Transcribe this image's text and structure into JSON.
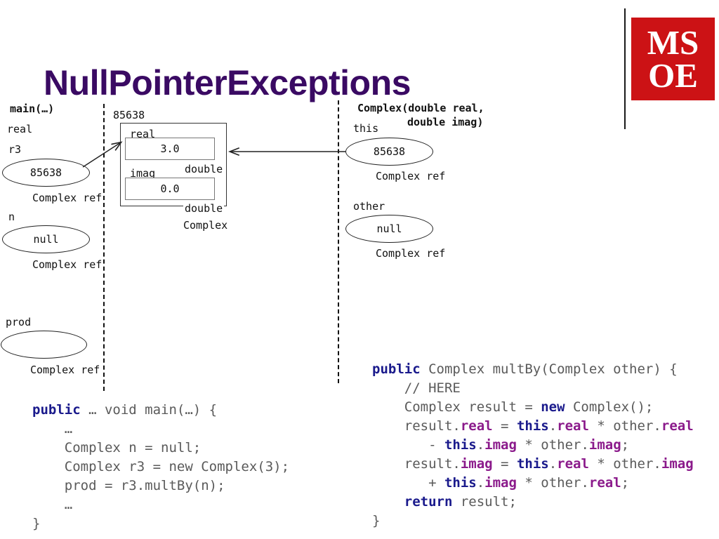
{
  "slide": {
    "title": "NullPointerExceptions",
    "title_color": "#3A0A63"
  },
  "logo": {
    "name": "msoe-logo",
    "line1": "MS",
    "line2": "OE",
    "background_color": "#CC1215",
    "text_color": "#FFFFFF"
  },
  "left_frame": {
    "frame_label": "main(…)",
    "stray_label": "real",
    "variables": [
      {
        "name": "r3",
        "value": "85638",
        "type_label": "Complex ref"
      },
      {
        "name": "n",
        "value": "null",
        "type_label": "Complex ref"
      },
      {
        "name": "prod",
        "value": "",
        "type_label": "Complex ref"
      }
    ]
  },
  "heap": {
    "address": "85638",
    "class_label": "Complex",
    "fields": [
      {
        "name": "real",
        "value": "3.0",
        "type_label": "double"
      },
      {
        "name": "imag",
        "value": "0.0",
        "type_label": "double"
      }
    ]
  },
  "right_frame": {
    "frame_label_line1": "Complex(double real,",
    "frame_label_line2": "double imag)",
    "variables": [
      {
        "name": "this",
        "value": "85638",
        "type_label": "Complex ref"
      },
      {
        "name": "other",
        "value": "null",
        "type_label": "Complex ref"
      }
    ]
  },
  "code_main": {
    "lines": [
      [
        {
          "t": "public",
          "c": "kw"
        },
        {
          "t": " … void main(…) {",
          "c": "plain"
        }
      ],
      [
        {
          "t": "    …",
          "c": "plain"
        }
      ],
      [
        {
          "t": "    Complex n = null;",
          "c": "plain"
        }
      ],
      [
        {
          "t": "    Complex r3 = new Complex(3);",
          "c": "plain"
        }
      ],
      [
        {
          "t": "    prod = r3.multBy(n);",
          "c": "plain"
        }
      ],
      [
        {
          "t": "    …",
          "c": "plain"
        }
      ],
      [
        {
          "t": "}",
          "c": "plain"
        }
      ]
    ]
  },
  "code_multby": {
    "lines": [
      [
        {
          "t": "public",
          "c": "kw"
        },
        {
          "t": " Complex multBy(Complex other) {",
          "c": "plain"
        }
      ],
      [
        {
          "t": "    // HERE",
          "c": "plain"
        }
      ],
      [
        {
          "t": "    Complex result = ",
          "c": "plain"
        },
        {
          "t": "new",
          "c": "kw"
        },
        {
          "t": " Complex();",
          "c": "plain"
        }
      ],
      [
        {
          "t": "    result.",
          "c": "plain"
        },
        {
          "t": "real",
          "c": "fld"
        },
        {
          "t": " = ",
          "c": "plain"
        },
        {
          "t": "this",
          "c": "kw"
        },
        {
          "t": ".",
          "c": "plain"
        },
        {
          "t": "real",
          "c": "fld"
        },
        {
          "t": " * other.",
          "c": "plain"
        },
        {
          "t": "real",
          "c": "fld"
        }
      ],
      [
        {
          "t": "       - ",
          "c": "plain"
        },
        {
          "t": "this",
          "c": "kw"
        },
        {
          "t": ".",
          "c": "plain"
        },
        {
          "t": "imag",
          "c": "fld"
        },
        {
          "t": " * other.",
          "c": "plain"
        },
        {
          "t": "imag",
          "c": "fld"
        },
        {
          "t": ";",
          "c": "plain"
        }
      ],
      [
        {
          "t": "    result.",
          "c": "plain"
        },
        {
          "t": "imag",
          "c": "fld"
        },
        {
          "t": " = ",
          "c": "plain"
        },
        {
          "t": "this",
          "c": "kw"
        },
        {
          "t": ".",
          "c": "plain"
        },
        {
          "t": "real",
          "c": "fld"
        },
        {
          "t": " * other.",
          "c": "plain"
        },
        {
          "t": "imag",
          "c": "fld"
        }
      ],
      [
        {
          "t": "       + ",
          "c": "plain"
        },
        {
          "t": "this",
          "c": "kw"
        },
        {
          "t": ".",
          "c": "plain"
        },
        {
          "t": "imag",
          "c": "fld"
        },
        {
          "t": " * other.",
          "c": "plain"
        },
        {
          "t": "real",
          "c": "fld"
        },
        {
          "t": ";",
          "c": "plain"
        }
      ],
      [
        {
          "t": "    ",
          "c": "plain"
        },
        {
          "t": "return",
          "c": "kw"
        },
        {
          "t": " result;",
          "c": "plain"
        }
      ],
      [
        {
          "t": "}",
          "c": "plain"
        }
      ]
    ]
  }
}
